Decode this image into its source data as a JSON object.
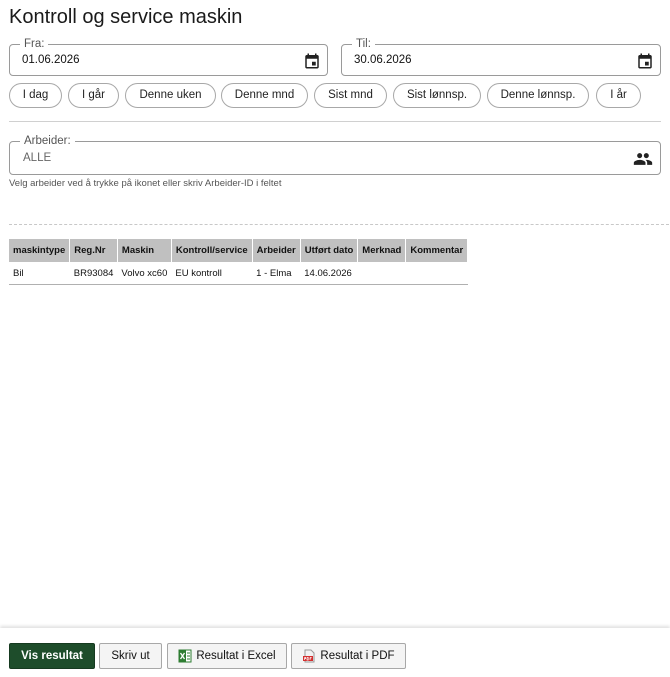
{
  "page": {
    "title": "Kontroll og service maskin"
  },
  "filters": {
    "from": {
      "label": "Fra:",
      "value": "01.06.2026",
      "icon": "calendar-icon"
    },
    "to": {
      "label": "Til:",
      "value": "30.06.2026",
      "icon": "calendar-icon"
    },
    "quick_ranges": [
      "I dag",
      "I går",
      "Denne uken",
      "Denne mnd",
      "Sist mnd",
      "Sist lønnsp.",
      "Denne lønnsp.",
      "I år"
    ]
  },
  "worker": {
    "label": "Arbeider:",
    "value": "ALLE",
    "icon": "people-icon",
    "hint": "Velg arbeider ved å trykke på ikonet eller skriv Arbeider-ID i feltet"
  },
  "table": {
    "headers": [
      "maskintype",
      "Reg.Nr",
      "Maskin",
      "Kontroll/service",
      "Arbeider",
      "Utført dato",
      "Merknad",
      "Kommentar"
    ],
    "rows": [
      [
        "Bil",
        "BR93084",
        "Volvo xc60",
        "EU kontroll",
        "1 - Elma",
        "14.06.2026",
        "",
        ""
      ]
    ]
  },
  "actions": {
    "show": "Vis resultat",
    "print": "Skriv ut",
    "excel": "Resultat i Excel",
    "pdf": "Resultat i PDF"
  },
  "colors": {
    "primary_button": "#1e4d2b",
    "header_bg": "#c0c0c0"
  }
}
